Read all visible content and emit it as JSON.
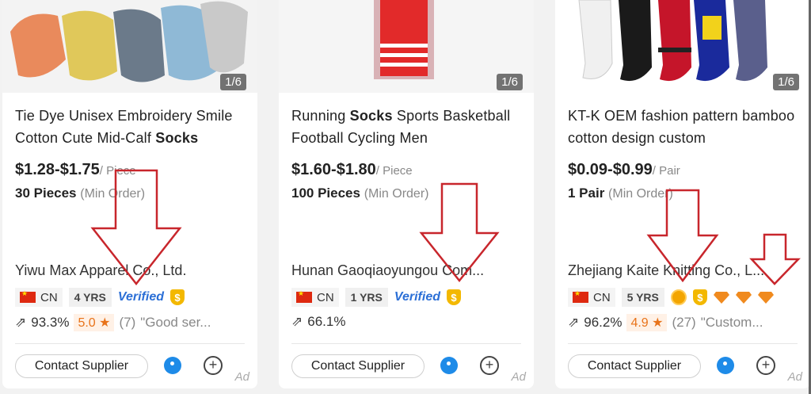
{
  "cards": [
    {
      "counter": "1/6",
      "title_pre": "Tie Dye Unisex Embroidery Smile Cotton Cute Mid-Calf ",
      "title_bold": "Socks",
      "title_post": "",
      "price": "$1.28-$1.75",
      "price_unit": "/ Piece",
      "moq": "30 Pieces",
      "moq_note": "(Min Order)",
      "supplier": "Yiwu Max Apparel Co., Ltd.",
      "country": "CN",
      "years": "4 YRS",
      "verified": "Verified",
      "shield": "$",
      "response_rate": "93.3%",
      "rating": "5.0 ★",
      "review_count": "(7)",
      "review_snippet": "\"Good ser...",
      "contact": "Contact Supplier",
      "ad": "Ad"
    },
    {
      "counter": "1/6",
      "title_pre": "Running ",
      "title_bold": "Socks",
      "title_post": " Sports Basketball Football Cycling Men",
      "price": "$1.60-$1.80",
      "price_unit": "/ Piece",
      "moq": "100 Pieces",
      "moq_note": "(Min Order)",
      "supplier": "Hunan Gaoqiaoyungou Com...",
      "country": "CN",
      "years": "1 YRS",
      "verified": "Verified",
      "shield": "$",
      "response_rate": "66.1%",
      "contact": "Contact Supplier",
      "ad": "Ad"
    },
    {
      "counter": "1/6",
      "title_pre": "KT-K OEM fashion pattern bamboo cotton design custom",
      "title_bold": "",
      "title_post": "",
      "price": "$0.09-$0.99",
      "price_unit": "/ Pair",
      "moq": "1 Pair",
      "moq_note": "(Min Order)",
      "supplier": "Zhejiang Kaite Knitting Co., L...",
      "country": "CN",
      "years": "5 YRS",
      "shield": "$",
      "response_rate": "96.2%",
      "rating": "4.9 ★",
      "review_count": "(27)",
      "review_snippet": "\"Custom...",
      "contact": "Contact Supplier",
      "ad": "Ad"
    }
  ],
  "colors": {
    "verified_blue": "#2b6fd6",
    "chat_blue": "#1e8be8",
    "rating_orange": "#e8731a",
    "arrow_red": "#c8262c",
    "gold": "#f3b800"
  }
}
